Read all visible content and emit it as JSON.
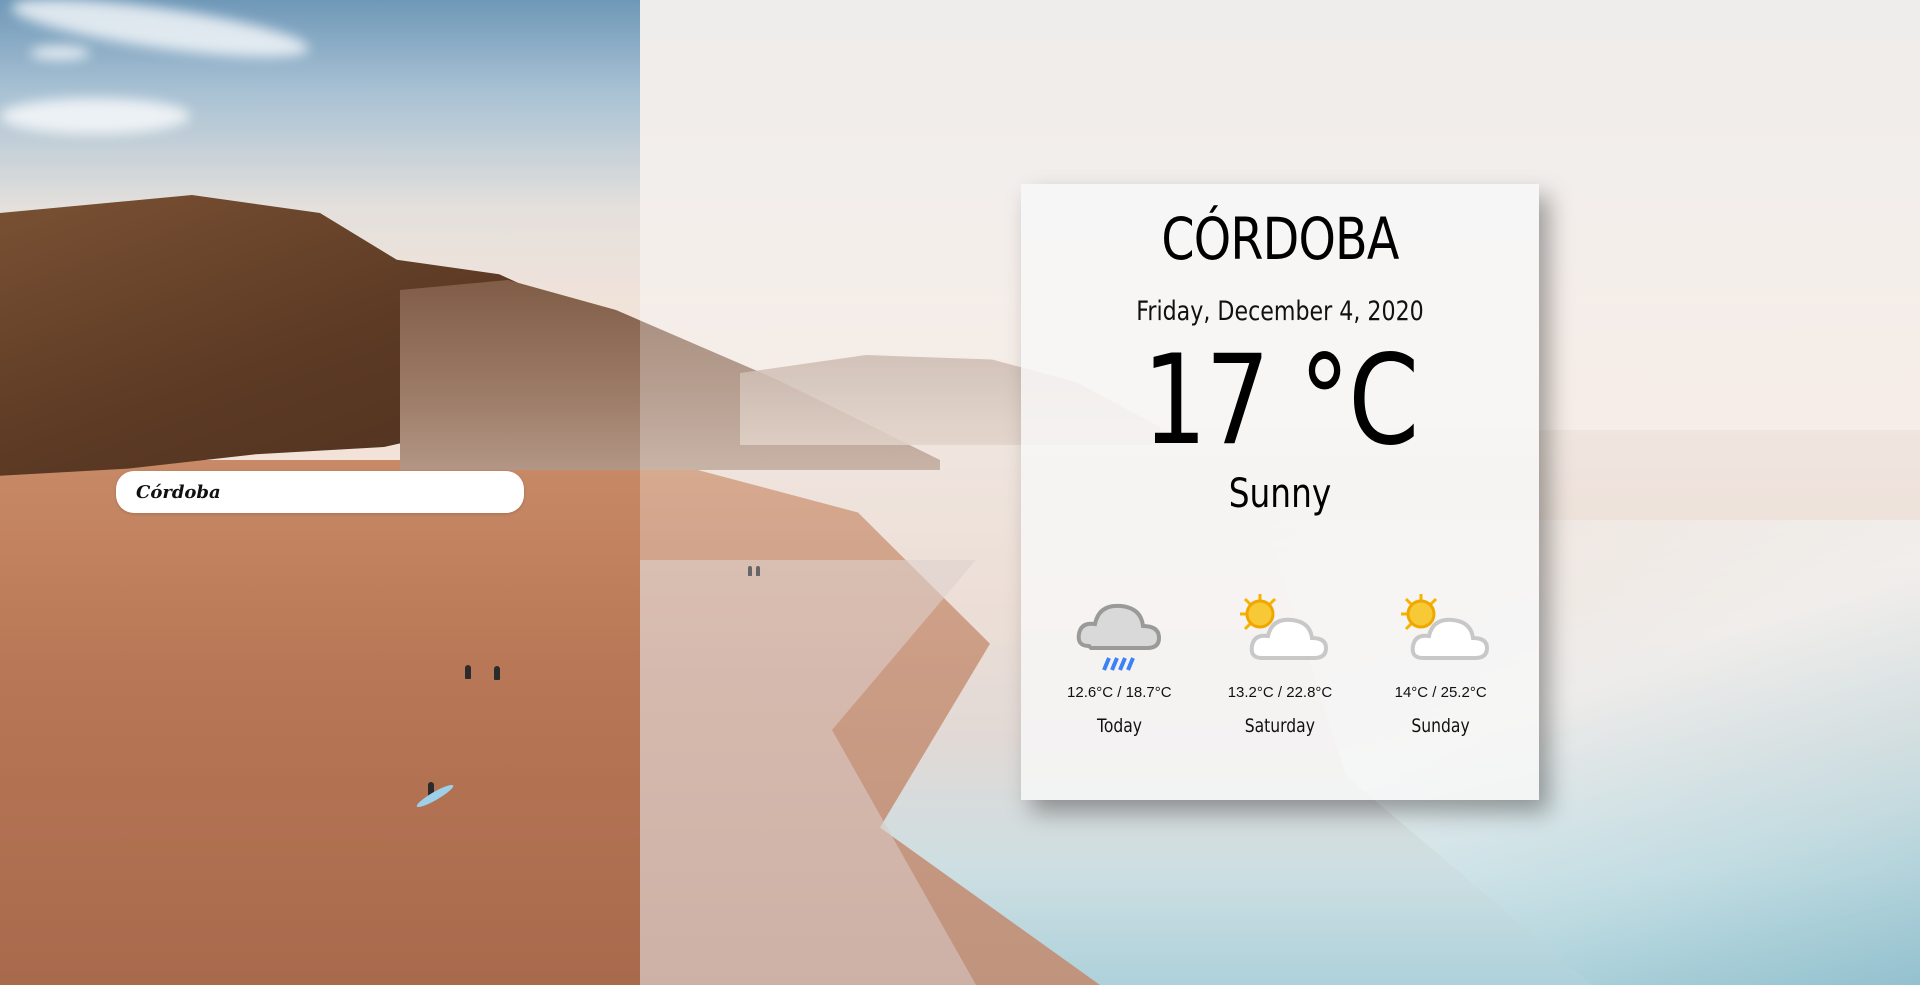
{
  "search": {
    "value": "Córdoba"
  },
  "weather": {
    "city": "CÓRDOBA",
    "date": "Friday, December 4, 2020",
    "temperature": "17 °C",
    "condition": "Sunny",
    "forecast": [
      {
        "day": "Today",
        "range": "12.6°C / 18.7°C",
        "icon": "rain-cloud-icon"
      },
      {
        "day": "Saturday",
        "range": "13.2°C / 22.8°C",
        "icon": "partly-cloudy-icon"
      },
      {
        "day": "Sunday",
        "range": "14°C / 25.2°C",
        "icon": "partly-cloudy-icon"
      }
    ]
  },
  "colors": {
    "rain": "#3b82f6",
    "sun": "#f5b400",
    "cloud": "#e6e6e6"
  }
}
